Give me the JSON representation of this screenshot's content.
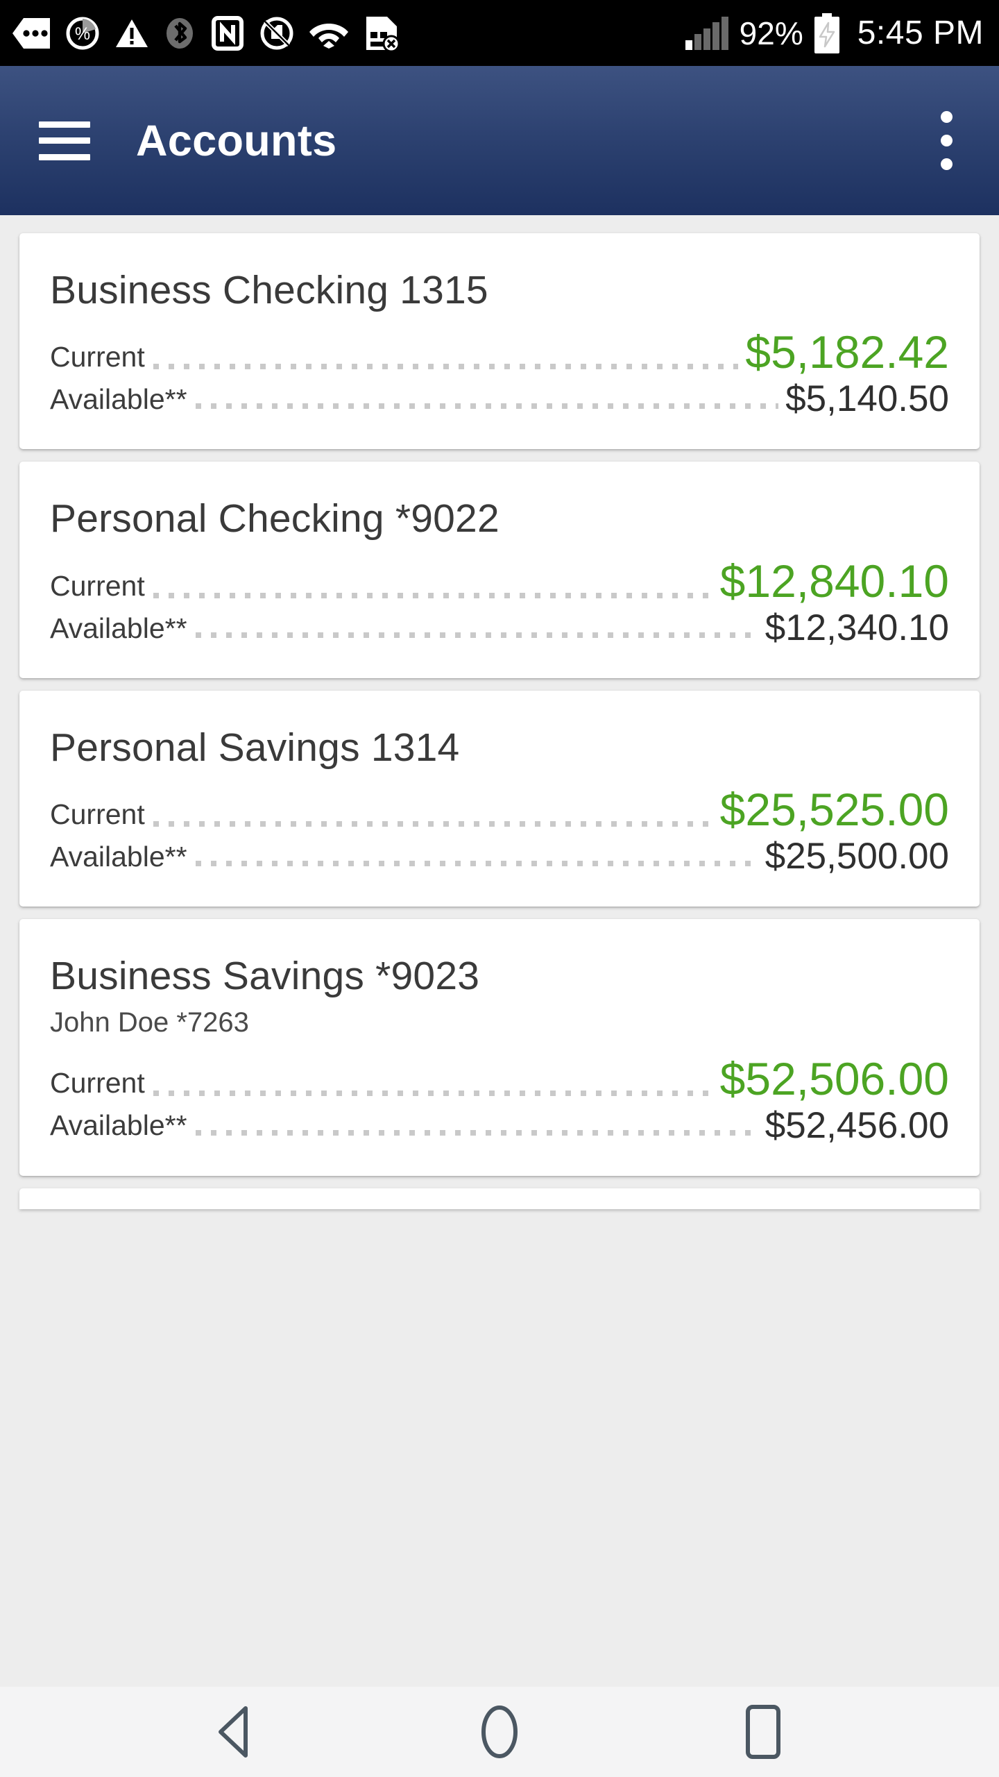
{
  "status_bar": {
    "left_icons": [
      "more-notifications-icon",
      "data-percent-icon",
      "warning-triangle-icon",
      "bluetooth-icon",
      "nfc-icon",
      "no-sim-icon",
      "wifi-icon",
      "sd-card-error-icon"
    ],
    "signal_icon": "cellular-signal-icon",
    "battery_percent": "92%",
    "battery_icon": "battery-charging-icon",
    "time": "5:45 PM"
  },
  "app_bar": {
    "menu_icon": "hamburger-menu-icon",
    "title": "Accounts",
    "overflow_icon": "overflow-menu-icon"
  },
  "labels": {
    "current": "Current",
    "available": "Available**"
  },
  "colors": {
    "app_bar_top": "#3d5281",
    "app_bar_bottom": "#1d3160",
    "current_amount": "#4ca423",
    "available_amount": "#2f2f2f",
    "page_background": "#ededed",
    "card_background": "#ffffff",
    "leader_dots": "#c9c9c9"
  },
  "accounts": [
    {
      "title": "Business Checking 1315",
      "subtitle": "",
      "current_label": "Current",
      "current_amount": "$5,182.42",
      "available_label": "Available**",
      "available_amount": "$5,140.50"
    },
    {
      "title": "Personal Checking *9022",
      "subtitle": "",
      "current_label": "Current",
      "current_amount": "$12,840.10",
      "available_label": "Available**",
      "available_amount": "$12,340.10"
    },
    {
      "title": "Personal Savings 1314",
      "subtitle": "",
      "current_label": "Current",
      "current_amount": "$25,525.00",
      "available_label": "Available**",
      "available_amount": "$25,500.00"
    },
    {
      "title": "Business Savings *9023",
      "subtitle": "John Doe *7263",
      "current_label": "Current",
      "current_amount": "$52,506.00",
      "available_label": "Available**",
      "available_amount": "$52,456.00"
    }
  ],
  "nav_bar": {
    "back": "back-icon",
    "home": "home-icon",
    "recents": "recents-icon"
  }
}
